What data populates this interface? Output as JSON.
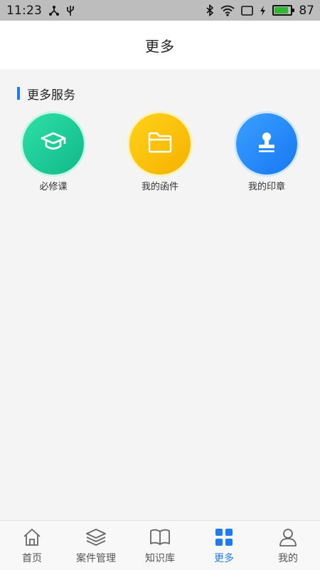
{
  "status_bar": {
    "time": "11:23",
    "battery_level": "87",
    "battery_fill_fraction": 0.87,
    "battery_color": "#2fb82f"
  },
  "nav": {
    "title": "更多"
  },
  "section": {
    "title": "更多服务",
    "accent_color": "#1d7cf2"
  },
  "services": [
    {
      "label": "必修课",
      "icon": "graduation-cap-icon",
      "color": "#12c28f"
    },
    {
      "label": "我的函件",
      "icon": "folder-icon",
      "color": "#f8c100"
    },
    {
      "label": "我的印章",
      "icon": "stamp-icon",
      "color": "#1f86f5"
    }
  ],
  "tabs": [
    {
      "label": "首页",
      "icon": "home-icon",
      "active": false
    },
    {
      "label": "案件管理",
      "icon": "layers-icon",
      "active": false
    },
    {
      "label": "知识库",
      "icon": "book-icon",
      "active": false
    },
    {
      "label": "更多",
      "icon": "grid-icon",
      "active": true
    },
    {
      "label": "我的",
      "icon": "user-icon",
      "active": false
    }
  ]
}
